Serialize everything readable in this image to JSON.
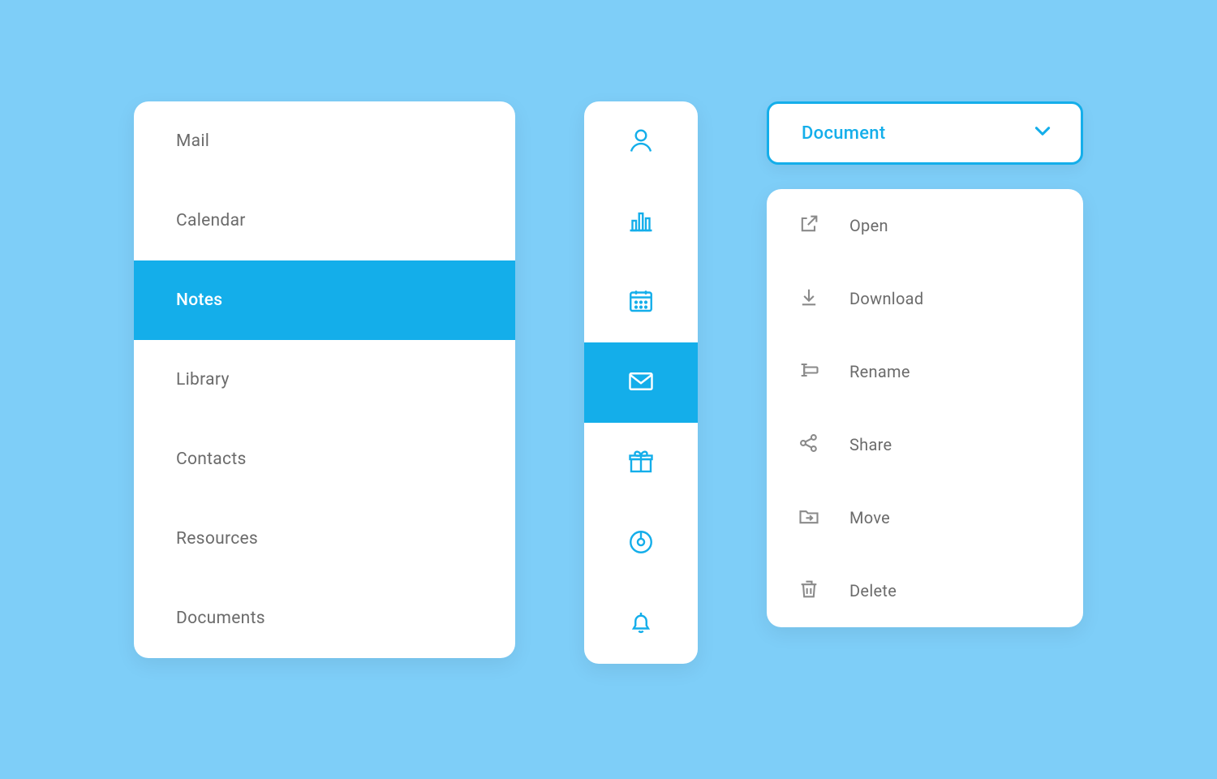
{
  "colors": {
    "background": "#7ecef8",
    "accent": "#14aeea",
    "text": "#6b6b6b",
    "iconGray": "#8a8a8a"
  },
  "nav": {
    "items": [
      {
        "label": "Mail",
        "active": false
      },
      {
        "label": "Calendar",
        "active": false
      },
      {
        "label": "Notes",
        "active": true
      },
      {
        "label": "Library",
        "active": false
      },
      {
        "label": "Contacts",
        "active": false
      },
      {
        "label": "Resources",
        "active": false
      },
      {
        "label": "Documents",
        "active": false
      }
    ]
  },
  "iconRail": {
    "items": [
      {
        "icon": "user",
        "active": false
      },
      {
        "icon": "bar-chart",
        "active": false
      },
      {
        "icon": "calendar",
        "active": false
      },
      {
        "icon": "mail",
        "active": true
      },
      {
        "icon": "gift",
        "active": false
      },
      {
        "icon": "disc",
        "active": false
      },
      {
        "icon": "bell",
        "active": false
      }
    ]
  },
  "dropdown": {
    "label": "Document"
  },
  "contextMenu": {
    "items": [
      {
        "icon": "open",
        "label": "Open"
      },
      {
        "icon": "download",
        "label": "Download"
      },
      {
        "icon": "rename",
        "label": "Rename"
      },
      {
        "icon": "share",
        "label": "Share"
      },
      {
        "icon": "move",
        "label": "Move"
      },
      {
        "icon": "delete",
        "label": "Delete"
      }
    ]
  }
}
